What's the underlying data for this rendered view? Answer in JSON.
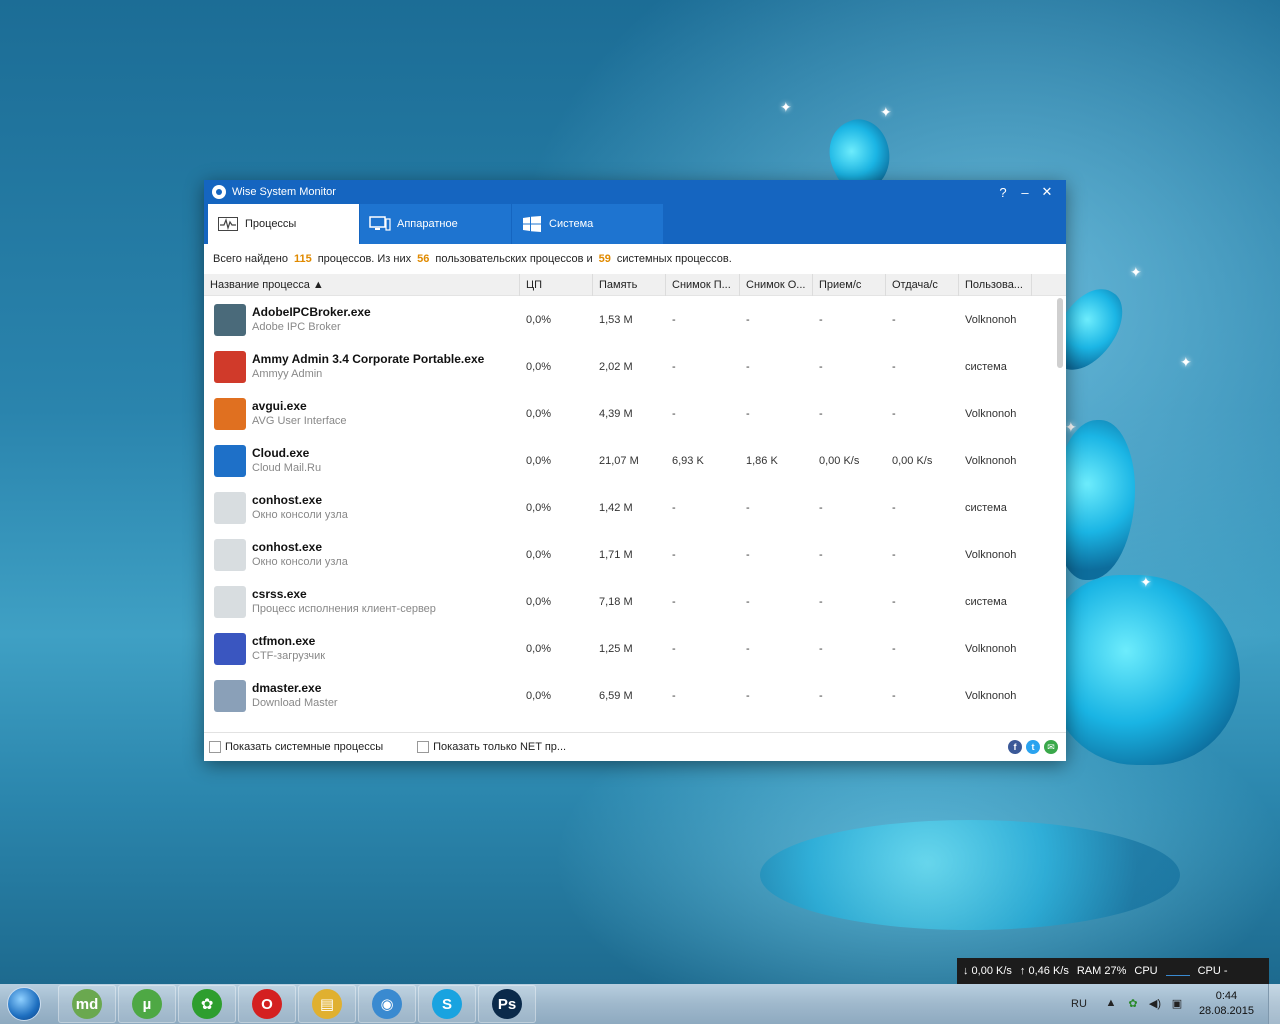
{
  "window": {
    "title": "Wise System Monitor",
    "help_glyph": "?",
    "minimize_glyph": "–",
    "close_glyph": "✕"
  },
  "tabs": [
    {
      "label": "Процессы",
      "icon": "activity-icon"
    },
    {
      "label": "Аппаратное",
      "icon": "monitor-icon"
    },
    {
      "label": "Система",
      "icon": "windows-logo-icon"
    }
  ],
  "summary": {
    "prefix": "Всего найдено",
    "total": "115",
    "mid1": "процессов. Из них",
    "user_count": "56",
    "mid2": "пользовательских процессов и",
    "system_count": "59",
    "suffix": "системных процессов."
  },
  "columns": [
    "Название процесса ▲",
    "ЦП",
    "Память",
    "Снимок П...",
    "Снимок О...",
    "Прием/с",
    "Отдача/с",
    "Пользова..."
  ],
  "processes": [
    {
      "name": "AdobeIPCBroker.exe",
      "desc": "Adobe IPC Broker",
      "cpu": "0,0%",
      "mem": "1,53 M",
      "s1": "-",
      "s2": "-",
      "rx": "-",
      "tx": "-",
      "user": "Volknonoh",
      "color": "#4a6a7a"
    },
    {
      "name": "Ammy Admin 3.4 Corporate Portable.exe",
      "desc": "Ammyy Admin",
      "cpu": "0,0%",
      "mem": "2,02 M",
      "s1": "-",
      "s2": "-",
      "rx": "-",
      "tx": "-",
      "user": "система",
      "color": "#d03a2a"
    },
    {
      "name": "avgui.exe",
      "desc": "AVG User Interface",
      "cpu": "0,0%",
      "mem": "4,39 M",
      "s1": "-",
      "s2": "-",
      "rx": "-",
      "tx": "-",
      "user": "Volknonoh",
      "color": "#e07020"
    },
    {
      "name": "Cloud.exe",
      "desc": "Cloud Mail.Ru",
      "cpu": "0,0%",
      "mem": "21,07 M",
      "s1": "6,93 K",
      "s2": "1,86 K",
      "rx": "0,00 K/s",
      "tx": "0,00 K/s",
      "user": "Volknonoh",
      "color": "#1e70c8"
    },
    {
      "name": "conhost.exe",
      "desc": "Окно консоли узла",
      "cpu": "0,0%",
      "mem": "1,42 M",
      "s1": "-",
      "s2": "-",
      "rx": "-",
      "tx": "-",
      "user": "система",
      "color": "#d8dde0"
    },
    {
      "name": "conhost.exe",
      "desc": "Окно консоли узла",
      "cpu": "0,0%",
      "mem": "1,71 M",
      "s1": "-",
      "s2": "-",
      "rx": "-",
      "tx": "-",
      "user": "Volknonoh",
      "color": "#d8dde0"
    },
    {
      "name": "csrss.exe",
      "desc": "Процесс исполнения клиент-сервер",
      "cpu": "0,0%",
      "mem": "7,18 M",
      "s1": "-",
      "s2": "-",
      "rx": "-",
      "tx": "-",
      "user": "система",
      "color": "#d8dde0"
    },
    {
      "name": "ctfmon.exe",
      "desc": "CTF-загрузчик",
      "cpu": "0,0%",
      "mem": "1,25 M",
      "s1": "-",
      "s2": "-",
      "rx": "-",
      "tx": "-",
      "user": "Volknonoh",
      "color": "#3a56c0"
    },
    {
      "name": "dmaster.exe",
      "desc": "Download Master",
      "cpu": "0,0%",
      "mem": "6,59 M",
      "s1": "-",
      "s2": "-",
      "rx": "-",
      "tx": "-",
      "user": "Volknonoh",
      "color": "#8aa0b8"
    }
  ],
  "footer": {
    "show_system": "Показать системные процессы",
    "show_net": "Показать только NET пр...",
    "social": [
      "f",
      "t",
      "✉"
    ]
  },
  "statsbar": {
    "down": "↓ 0,00 K/s",
    "up": "↑ 0,46 K/s",
    "ram": "RAM 27%",
    "cpu1": "CPU",
    "cpu2": "CPU -"
  },
  "taskbar": {
    "apps": [
      {
        "name": "mediaget-button",
        "label": "md",
        "color": "#6aa84f"
      },
      {
        "name": "utorrent-button",
        "label": "µ",
        "color": "#4ea844"
      },
      {
        "name": "icq-button",
        "label": "✿",
        "color": "#2e9e2e"
      },
      {
        "name": "opera-button",
        "label": "O",
        "color": "#d42020"
      },
      {
        "name": "explorer-button",
        "label": "▤",
        "color": "#e0b030"
      },
      {
        "name": "wise-monitor-button",
        "label": "◉",
        "color": "#3a8ad0"
      },
      {
        "name": "skype-button",
        "label": "S",
        "color": "#19a3e0"
      },
      {
        "name": "photoshop-button",
        "label": "Ps",
        "color": "#0b2a4a"
      }
    ],
    "lang": "RU",
    "time": "0:44",
    "date": "28.08.2015"
  }
}
